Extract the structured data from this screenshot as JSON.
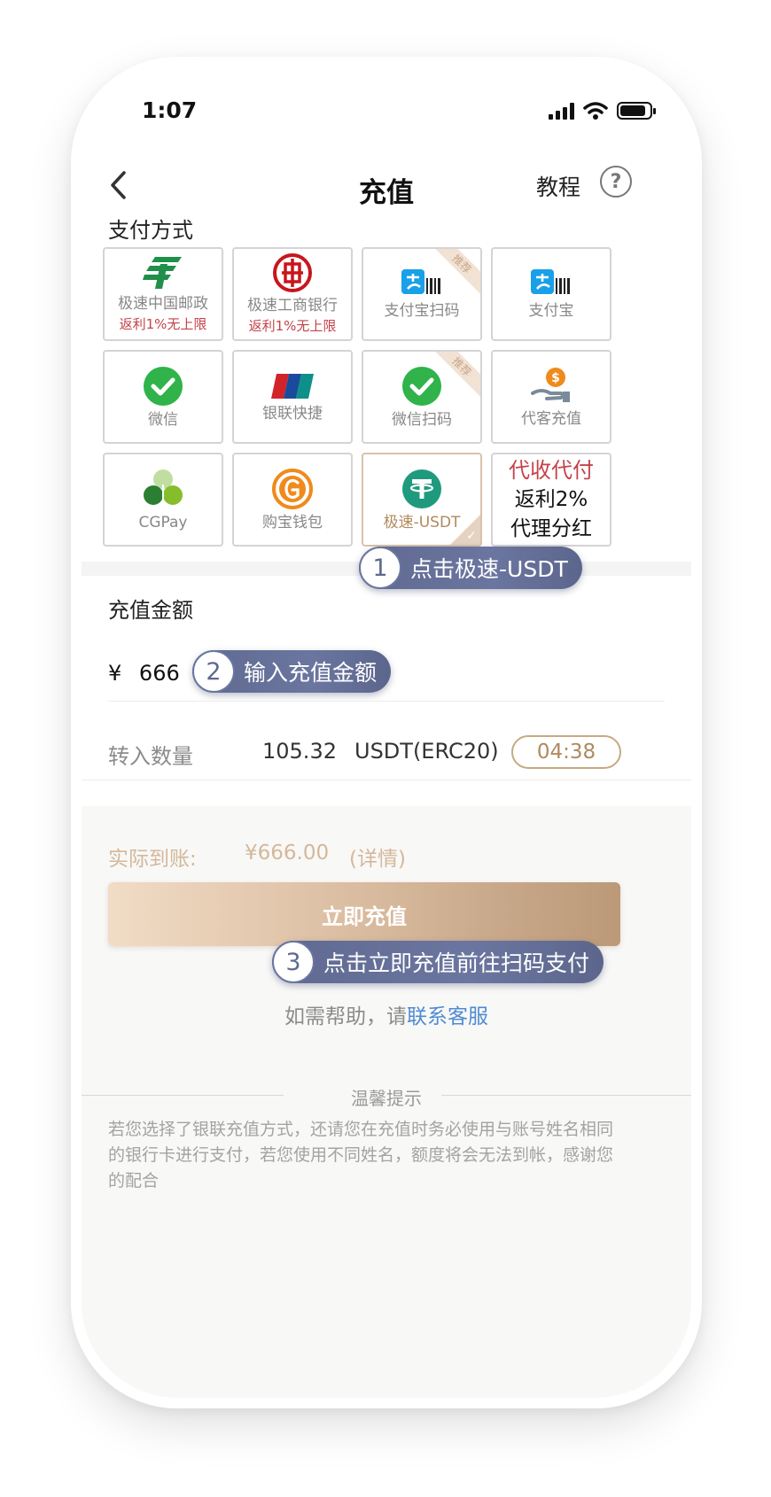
{
  "status_bar": {
    "time": "1:07"
  },
  "header": {
    "title": "充值",
    "tutorial": "教程",
    "help_symbol": "?"
  },
  "payment": {
    "section_label": "支付方式",
    "methods": [
      {
        "label": "极速中国邮政",
        "sub": "返利1%无上限",
        "icon": "china-post-icon"
      },
      {
        "label": "极速工商银行",
        "sub": "返利1%无上限",
        "icon": "icbc-icon"
      },
      {
        "label": "支付宝扫码",
        "ribbon": "推荐",
        "icon": "alipay-scan-icon"
      },
      {
        "label": "支付宝",
        "icon": "alipay-icon"
      },
      {
        "label": "微信",
        "icon": "wechat-icon"
      },
      {
        "label": "银联快捷",
        "icon": "unionpay-icon"
      },
      {
        "label": "微信扫码",
        "ribbon": "推荐",
        "icon": "wechat-scan-icon"
      },
      {
        "label": "代客充值",
        "icon": "agent-recharge-icon"
      },
      {
        "label": "CGPay",
        "icon": "cgpay-icon"
      },
      {
        "label": "购宝钱包",
        "icon": "goubao-wallet-icon"
      },
      {
        "label": "极速-USDT",
        "icon": "usdt-icon",
        "selected": true,
        "check": "✓"
      }
    ],
    "promo": {
      "line1": "代收代付",
      "line2": "返利2%",
      "line3": "代理分红"
    }
  },
  "callouts": [
    {
      "num": "1",
      "text": "点击极速-USDT"
    },
    {
      "num": "2",
      "text": "输入充值金额"
    },
    {
      "num": "3",
      "text": "点击立即充值前往扫码支付"
    }
  ],
  "amount": {
    "section_label": "充值金额",
    "currency": "¥",
    "value": "666",
    "transfer_label": "转入数量",
    "transfer_value": "105.32",
    "transfer_unit": "USDT(ERC20)",
    "timer": "04:38"
  },
  "summary": {
    "actual_label": "实际到账:",
    "actual_value": "¥666.00",
    "detail": "(详情)",
    "submit": "立即充值",
    "help_prefix": "如需帮助，请",
    "help_link": "联系客服"
  },
  "tips": {
    "title": "温馨提示",
    "body": "若您选择了银联充值方式，还请您在充值时务必使用与账号姓名相同的银行卡进行支付，若您使用不同姓名，额度将会无法到帐，感谢您的配合"
  },
  "colors": {
    "accent": "#c8a982",
    "callout": "#5f6990",
    "warning_red": "#c4434a",
    "link_blue": "#4f8bd0"
  }
}
